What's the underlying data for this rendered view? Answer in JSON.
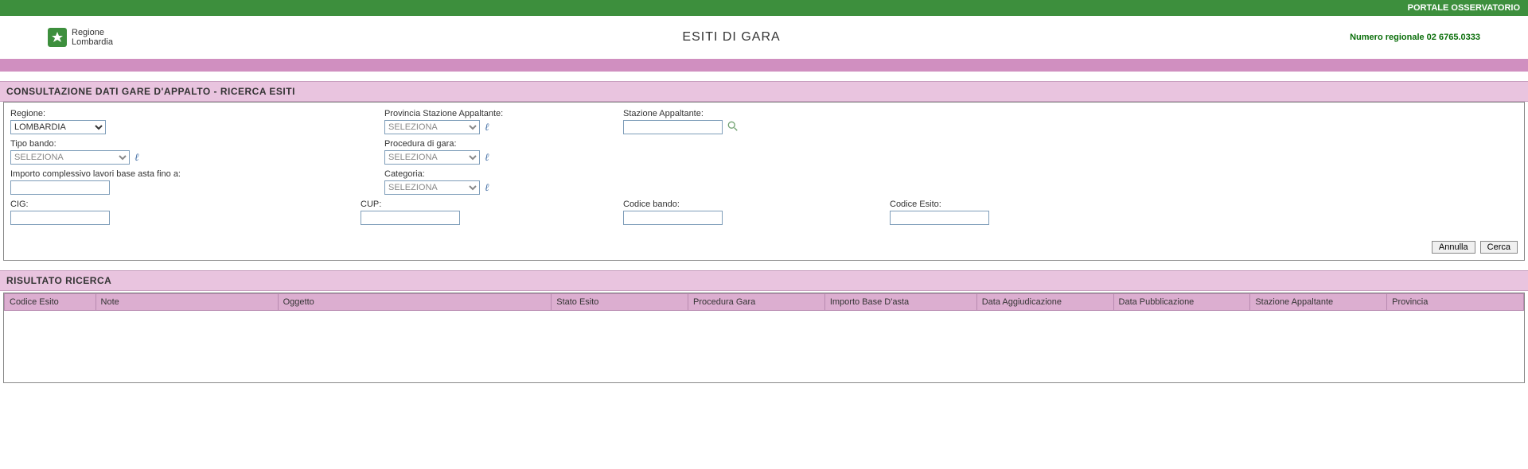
{
  "topbar": {
    "label": "PORTALE OSSERVATORIO"
  },
  "header": {
    "logo_line1": "Regione",
    "logo_line2": "Lombardia",
    "title": "ESITI DI GARA",
    "phone": "Numero regionale 02 6765.0333"
  },
  "form": {
    "section_title": "CONSULTAZIONE DATI GARE D'APPALTO - RICERCA ESITI",
    "regione_label": "Regione:",
    "regione_value": "LOMBARDIA",
    "provincia_label": "Provincia Stazione Appaltante:",
    "provincia_value": "SELEZIONA",
    "stazione_label": "Stazione Appaltante:",
    "tipo_bando_label": "Tipo bando:",
    "tipo_bando_value": "SELEZIONA",
    "procedura_label": "Procedura di gara:",
    "procedura_value": "SELEZIONA",
    "importo_label": "Importo complessivo lavori base asta fino a:",
    "categoria_label": "Categoria:",
    "categoria_value": "SELEZIONA",
    "cig_label": "CIG:",
    "cup_label": "CUP:",
    "codice_bando_label": "Codice bando:",
    "codice_esito_label": "Codice Esito:",
    "btn_annulla": "Annulla",
    "btn_cerca": "Cerca"
  },
  "results": {
    "section_title": "RISULTATO RICERCA",
    "columns": [
      "Codice Esito",
      "Note",
      "Oggetto",
      "Stato Esito",
      "Procedura Gara",
      "Importo Base D'asta",
      "Data Aggiudicazione",
      "Data Pubblicazione",
      "Stazione Appaltante",
      "Provincia"
    ]
  }
}
